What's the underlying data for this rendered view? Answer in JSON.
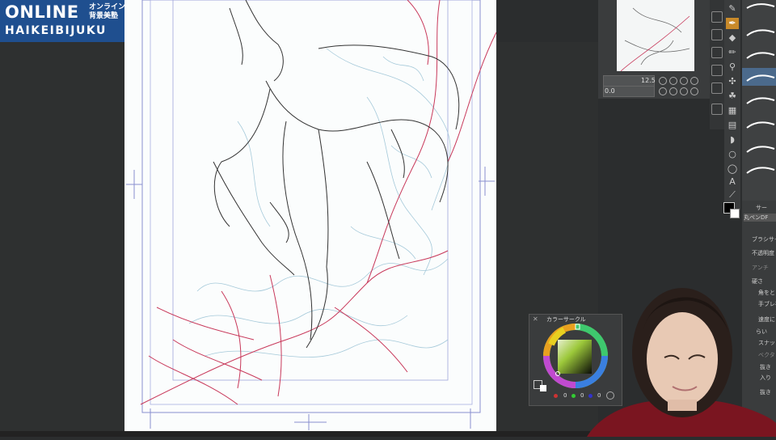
{
  "logo": {
    "title": "ONLINE",
    "jp_line1": "オンライン",
    "jp_line2": "背景美塾",
    "subtitle": "HAIKEIBIJUKU"
  },
  "navigator": {
    "zoom_value": "12.5",
    "rotation_value": "0.0"
  },
  "subtool_panel": {
    "tab_label": "サー",
    "brush_name": "丸ペンDF",
    "brush_size_label": "ブラシサイ",
    "opacity_label": "不透明度",
    "antialias_label": "アンチ",
    "hardness_label": "硬さ",
    "corner_label": "角をと",
    "stabilization_label": "手ブレ補正",
    "speed_label": "速度に",
    "smoothness_label": "らい",
    "snap_label": "スナッ",
    "vector_label": "ベクタ",
    "stroke_in_label": "抜き",
    "in_label": "入り",
    "stroke_out_label": "抜き"
  },
  "color_circle": {
    "title": "カラーサークル",
    "r": "0",
    "g": "0",
    "b": "0",
    "fg_color": "#000000",
    "bg_color": "#ffffff"
  },
  "colors": {
    "logo_bg": "#1f4f8f",
    "accent_red": "#c8385a",
    "panel_bg": "#3a3c3d"
  },
  "icons": [
    "eyedropper-icon",
    "pen-icon",
    "eraser-icon",
    "pencil-icon",
    "brush-icon",
    "airbrush-icon",
    "fill-icon",
    "gradient-icon",
    "text-icon",
    "figure-icon",
    "lasso-icon",
    "move-icon"
  ]
}
